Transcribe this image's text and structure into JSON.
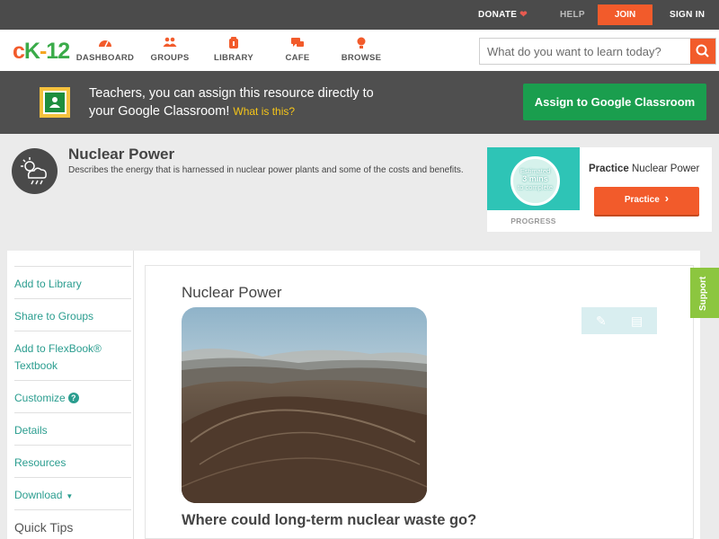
{
  "topbar": {
    "donate": "DONATE",
    "help": "HELP",
    "join": "JOIN",
    "sign_in": "SIGN IN"
  },
  "logo": {
    "c": "c",
    "k": "K",
    "dash": "-",
    "num": "12"
  },
  "nav": {
    "items": [
      {
        "label": "DASHBOARD",
        "icon": "dashboard-icon"
      },
      {
        "label": "GROUPS",
        "icon": "groups-icon"
      },
      {
        "label": "LIBRARY",
        "icon": "library-icon"
      },
      {
        "label": "CAFE",
        "icon": "cafe-icon"
      },
      {
        "label": "BROWSE",
        "icon": "browse-icon"
      }
    ],
    "search_placeholder": "What do you want to learn today?"
  },
  "banner": {
    "text": "Teachers, you can assign this resource directly to your Google Classroom!",
    "what_is_this": "What is this?",
    "assign_button": "Assign to Google Classroom"
  },
  "header": {
    "title": "Nuclear Power",
    "description": "Describes the energy that is harnessed in nuclear power plants and some of the costs and benefits."
  },
  "practice": {
    "estimated": "Estimated",
    "mins": "3 mins",
    "to_complete": "to complete",
    "progress_label": "PROGRESS",
    "title_bold": "Practice",
    "title_rest": "Nuclear Power",
    "button": "Practice"
  },
  "sidebar": {
    "items": [
      {
        "label": "Add to Library"
      },
      {
        "label": "Share to Groups"
      },
      {
        "label": "Add to FlexBook® Textbook"
      },
      {
        "label": "Customize"
      },
      {
        "label": "Details"
      },
      {
        "label": "Resources"
      },
      {
        "label": "Download"
      },
      {
        "label": "Quick Tips"
      }
    ]
  },
  "article": {
    "title": "Nuclear Power",
    "question": "Where could long-term nuclear waste go?"
  },
  "support": "Support",
  "colors": {
    "accent": "#f25b2b",
    "teal": "#2a9d8f",
    "green": "#1a9e4e",
    "support_green": "#8cc63f"
  }
}
